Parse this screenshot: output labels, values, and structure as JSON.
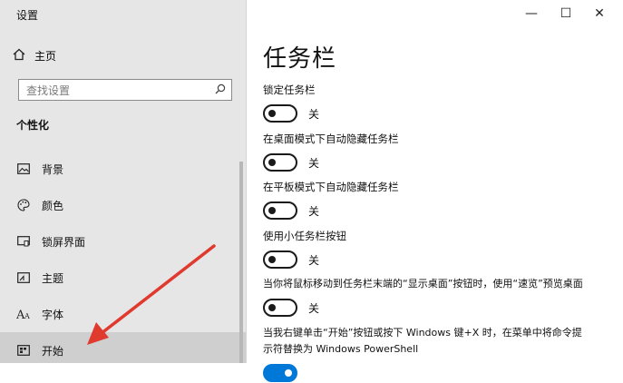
{
  "window": {
    "title": "设置",
    "minimize_label": "—",
    "maximize_label": "☐",
    "close_label": "✕"
  },
  "sidebar": {
    "home_label": "主页",
    "search_placeholder": "查找设置",
    "section_title": "个性化",
    "items": [
      {
        "label": "背景",
        "icon": "image-icon"
      },
      {
        "label": "颜色",
        "icon": "palette-icon"
      },
      {
        "label": "锁屏界面",
        "icon": "lock-screen-icon"
      },
      {
        "label": "主题",
        "icon": "theme-icon"
      },
      {
        "label": "字体",
        "icon": "font-icon"
      },
      {
        "label": "开始",
        "icon": "start-icon",
        "active": true
      }
    ]
  },
  "main": {
    "title": "任务栏",
    "settings": [
      {
        "label": "锁定任务栏",
        "state": "关"
      },
      {
        "label": "在桌面模式下自动隐藏任务栏",
        "state": "关"
      },
      {
        "label": "在平板模式下自动隐藏任务栏",
        "state": "关"
      },
      {
        "label": "使用小任务栏按钮",
        "state": "关"
      },
      {
        "label": "当你将鼠标移动到任务栏末端的“显示桌面”按钮时，使用“速览”预览桌面",
        "state": "关"
      },
      {
        "label_line1": "当我右键单击“开始”按钮或按下 Windows 键+X 时，在菜单中将命令提",
        "label_line2": "示符替换为 Windows PowerShell"
      }
    ]
  },
  "colors": {
    "sidebar_bg": "#e6e6e6",
    "accent": "#0078d7",
    "arrow": "#e03a2f"
  }
}
